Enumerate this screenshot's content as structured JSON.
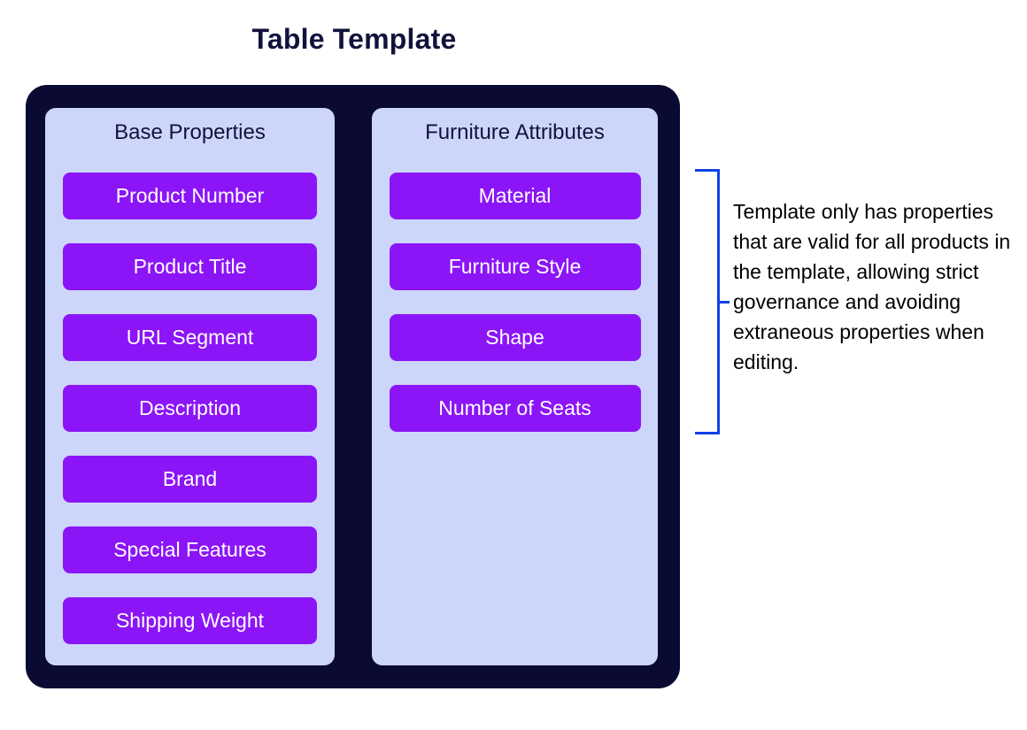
{
  "page": {
    "title": "Table Template"
  },
  "colors": {
    "container_bg": "#0a0a32",
    "column_bg": "#ccd6fb",
    "pill_bg": "#8b15f7",
    "pill_text": "#ffffff",
    "title_text": "#12123c",
    "header_text": "#12123c",
    "bracket": "#1141e8",
    "annotation_text": "#000000",
    "page_bg": "#ffffff"
  },
  "groups": [
    {
      "header": "Base Properties",
      "properties": [
        "Product Number",
        "Product Title",
        "URL Segment",
        "Description",
        "Brand",
        "Special Features",
        "Shipping Weight"
      ]
    },
    {
      "header": "Furniture Attributes",
      "properties": [
        "Material",
        "Furniture Style",
        "Shape",
        "Number of Seats"
      ]
    }
  ],
  "annotation": {
    "text": "Template only has properties that are valid for all products in the template, allowing strict governance and avoiding extraneous properties when editing."
  }
}
